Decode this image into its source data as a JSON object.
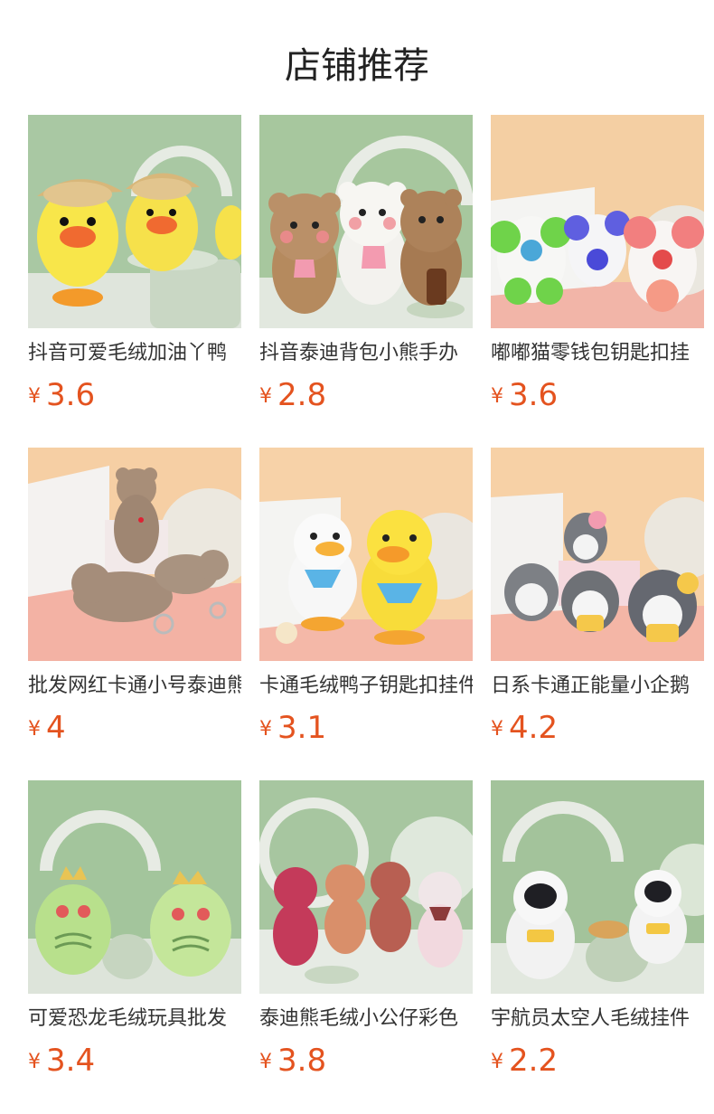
{
  "header": {
    "title": "店铺推荐"
  },
  "currency_symbol": "¥",
  "products": [
    {
      "name": "抖音可爱毛绒加油丫鸭",
      "price": "3.6",
      "thumb_icon": "yellow-duck-plush"
    },
    {
      "name": "抖音泰迪背包小熊手办",
      "price": "2.8",
      "thumb_icon": "teddy-bear-plush"
    },
    {
      "name": "嘟嘟猫零钱包钥匙扣挂",
      "price": "3.6",
      "thumb_icon": "colorful-cat-plush"
    },
    {
      "name": "批发网红卡通小号泰迪熊",
      "price": "4",
      "thumb_icon": "brown-bear-keychain"
    },
    {
      "name": "卡通毛绒鸭子钥匙扣挂件",
      "price": "3.1",
      "thumb_icon": "duck-pair-plush"
    },
    {
      "name": "日系卡通正能量小企鹅",
      "price": "4.2",
      "thumb_icon": "penguin-plush"
    },
    {
      "name": "可爱恐龙毛绒玩具批发",
      "price": "3.4",
      "thumb_icon": "green-dinosaur-plush"
    },
    {
      "name": "泰迪熊毛绒小公仔彩色",
      "price": "3.8",
      "thumb_icon": "colorful-teddy-bears"
    },
    {
      "name": "宇航员太空人毛绒挂件",
      "price": "2.2",
      "thumb_icon": "astronaut-plush"
    }
  ]
}
